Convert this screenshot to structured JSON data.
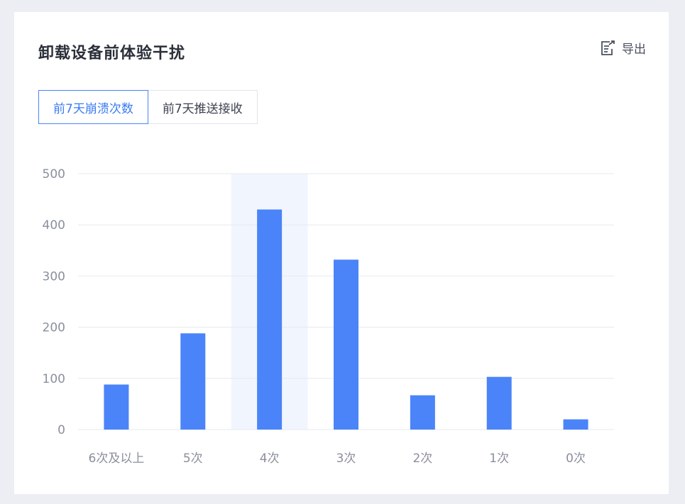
{
  "header": {
    "title": "卸载设备前体验干扰",
    "export_label": "导出"
  },
  "tabs": [
    {
      "label": "前7天崩溃次数",
      "active": true
    },
    {
      "label": "前7天推送接收",
      "active": false
    }
  ],
  "colors": {
    "bar": "#4a84f8",
    "highlight": "#f1f5fe",
    "grid": "#e6e9ef",
    "axis_text": "#8a8f9c",
    "tab_active": "#4a85f6"
  },
  "chart_data": {
    "type": "bar",
    "categories": [
      "6次及以上",
      "5次",
      "4次",
      "3次",
      "2次",
      "1次",
      "0次"
    ],
    "values": [
      88,
      188,
      430,
      332,
      67,
      103,
      20
    ],
    "ylim": [
      0,
      500
    ],
    "yticks": [
      0,
      100,
      200,
      300,
      400,
      500
    ],
    "highlighted_category": "4次",
    "grid": true,
    "legend": "none"
  }
}
